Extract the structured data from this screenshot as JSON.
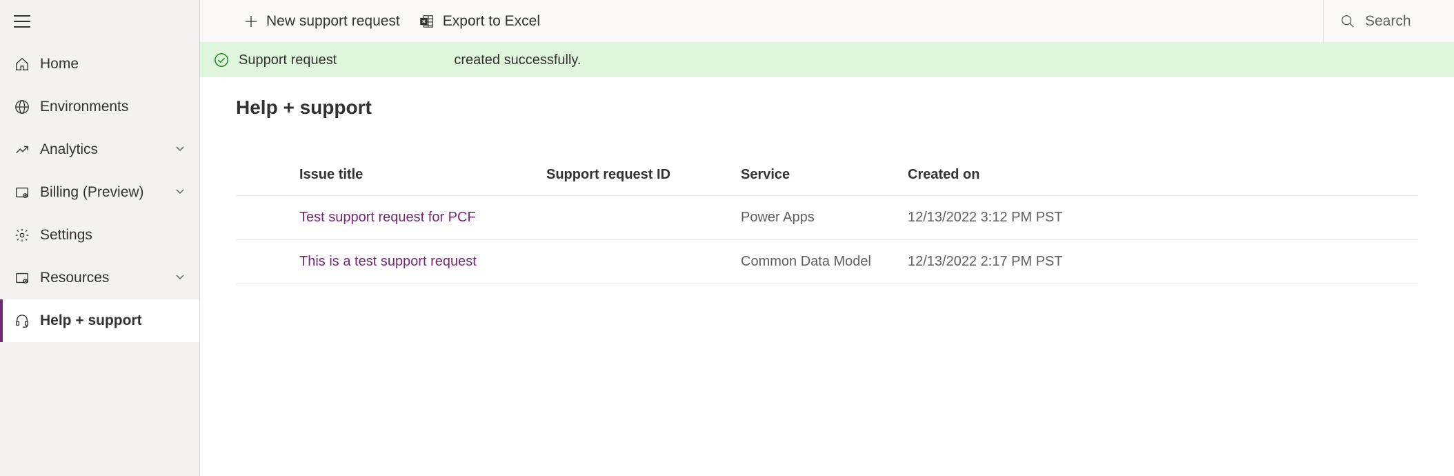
{
  "sidebar": {
    "items": [
      {
        "label": "Home",
        "icon": "home",
        "expandable": false,
        "selected": false
      },
      {
        "label": "Environments",
        "icon": "globe",
        "expandable": false,
        "selected": false
      },
      {
        "label": "Analytics",
        "icon": "analytics",
        "expandable": true,
        "selected": false
      },
      {
        "label": "Billing (Preview)",
        "icon": "billing",
        "expandable": true,
        "selected": false
      },
      {
        "label": "Settings",
        "icon": "gear",
        "expandable": false,
        "selected": false
      },
      {
        "label": "Resources",
        "icon": "resources",
        "expandable": true,
        "selected": false
      },
      {
        "label": "Help + support",
        "icon": "headset",
        "expandable": false,
        "selected": true
      }
    ]
  },
  "toolbar": {
    "new_request_label": "New support request",
    "export_label": "Export to Excel",
    "search_label": "Search"
  },
  "notification": {
    "bold": "Support request",
    "text": "created successfully."
  },
  "page": {
    "title": "Help + support"
  },
  "table": {
    "headers": {
      "issue_title": "Issue title",
      "request_id": "Support request ID",
      "service": "Service",
      "created_on": "Created on"
    },
    "rows": [
      {
        "issue_title": "Test support request for PCF",
        "request_id": "",
        "service": "Power Apps",
        "created_on": "12/13/2022 3:12 PM PST"
      },
      {
        "issue_title": "This is a test support request",
        "request_id": "",
        "service": "Common Data Model",
        "created_on": "12/13/2022 2:17 PM PST"
      }
    ]
  }
}
